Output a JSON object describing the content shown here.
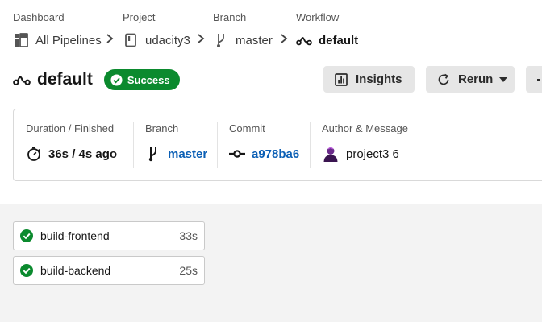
{
  "breadcrumb": {
    "dashboard": {
      "label": "Dashboard",
      "value": "All Pipelines"
    },
    "project": {
      "label": "Project",
      "value": "udacity3"
    },
    "branch": {
      "label": "Branch",
      "value": "master"
    },
    "workflow": {
      "label": "Workflow",
      "value": "default"
    }
  },
  "header": {
    "title": "default",
    "status": "Success",
    "insights_label": "Insights",
    "rerun_label": "Rerun"
  },
  "summary": {
    "duration": {
      "label": "Duration / Finished",
      "value": "36s / 4s ago"
    },
    "branch": {
      "label": "Branch",
      "value": "master"
    },
    "commit": {
      "label": "Commit",
      "value": "a978ba6"
    },
    "author": {
      "label": "Author & Message",
      "value": "project3 6"
    }
  },
  "jobs": [
    {
      "name": "build-frontend",
      "duration": "33s"
    },
    {
      "name": "build-backend",
      "duration": "25s"
    }
  ],
  "colors": {
    "success": "#0b8a2e",
    "link": "#0b5fb5",
    "button_bg": "#e6e6e6"
  },
  "icons": {
    "dashboard": "grid-icon",
    "project": "repo-icon",
    "branch": "branch-icon",
    "workflow": "workflow-icon",
    "insights": "bar-chart-icon",
    "rerun": "rerun-icon",
    "duration": "stopwatch-icon",
    "commit": "commit-icon",
    "status": "check-circle-icon"
  }
}
